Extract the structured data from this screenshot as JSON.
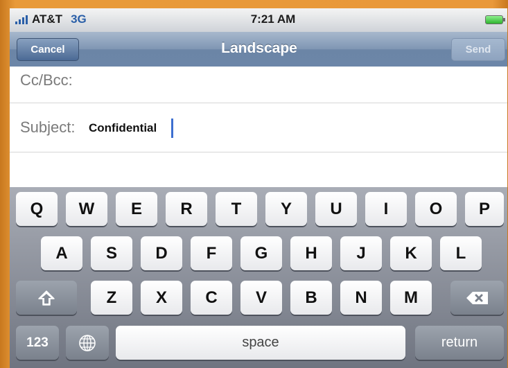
{
  "status_bar": {
    "carrier": "AT&T",
    "network": "3G",
    "time": "7:21 AM"
  },
  "nav": {
    "cancel_label": "Cancel",
    "title": "Landscape",
    "send_label": "Send"
  },
  "compose": {
    "cc_label": "Cc/Bcc:",
    "subject_label": "Subject:",
    "subject_value": "Confidential"
  },
  "keyboard": {
    "row1": [
      "Q",
      "W",
      "E",
      "R",
      "T",
      "Y",
      "U",
      "I",
      "O",
      "P"
    ],
    "row2": [
      "A",
      "S",
      "D",
      "F",
      "G",
      "H",
      "J",
      "K",
      "L"
    ],
    "row3": [
      "Z",
      "X",
      "C",
      "V",
      "B",
      "N",
      "M"
    ],
    "numbers_label": "123",
    "space_label": "space",
    "return_label": "return"
  },
  "colors": {
    "accent": "#3d6fd0",
    "nav_bar": "#6b85a6",
    "frame": "#e89a3a"
  }
}
